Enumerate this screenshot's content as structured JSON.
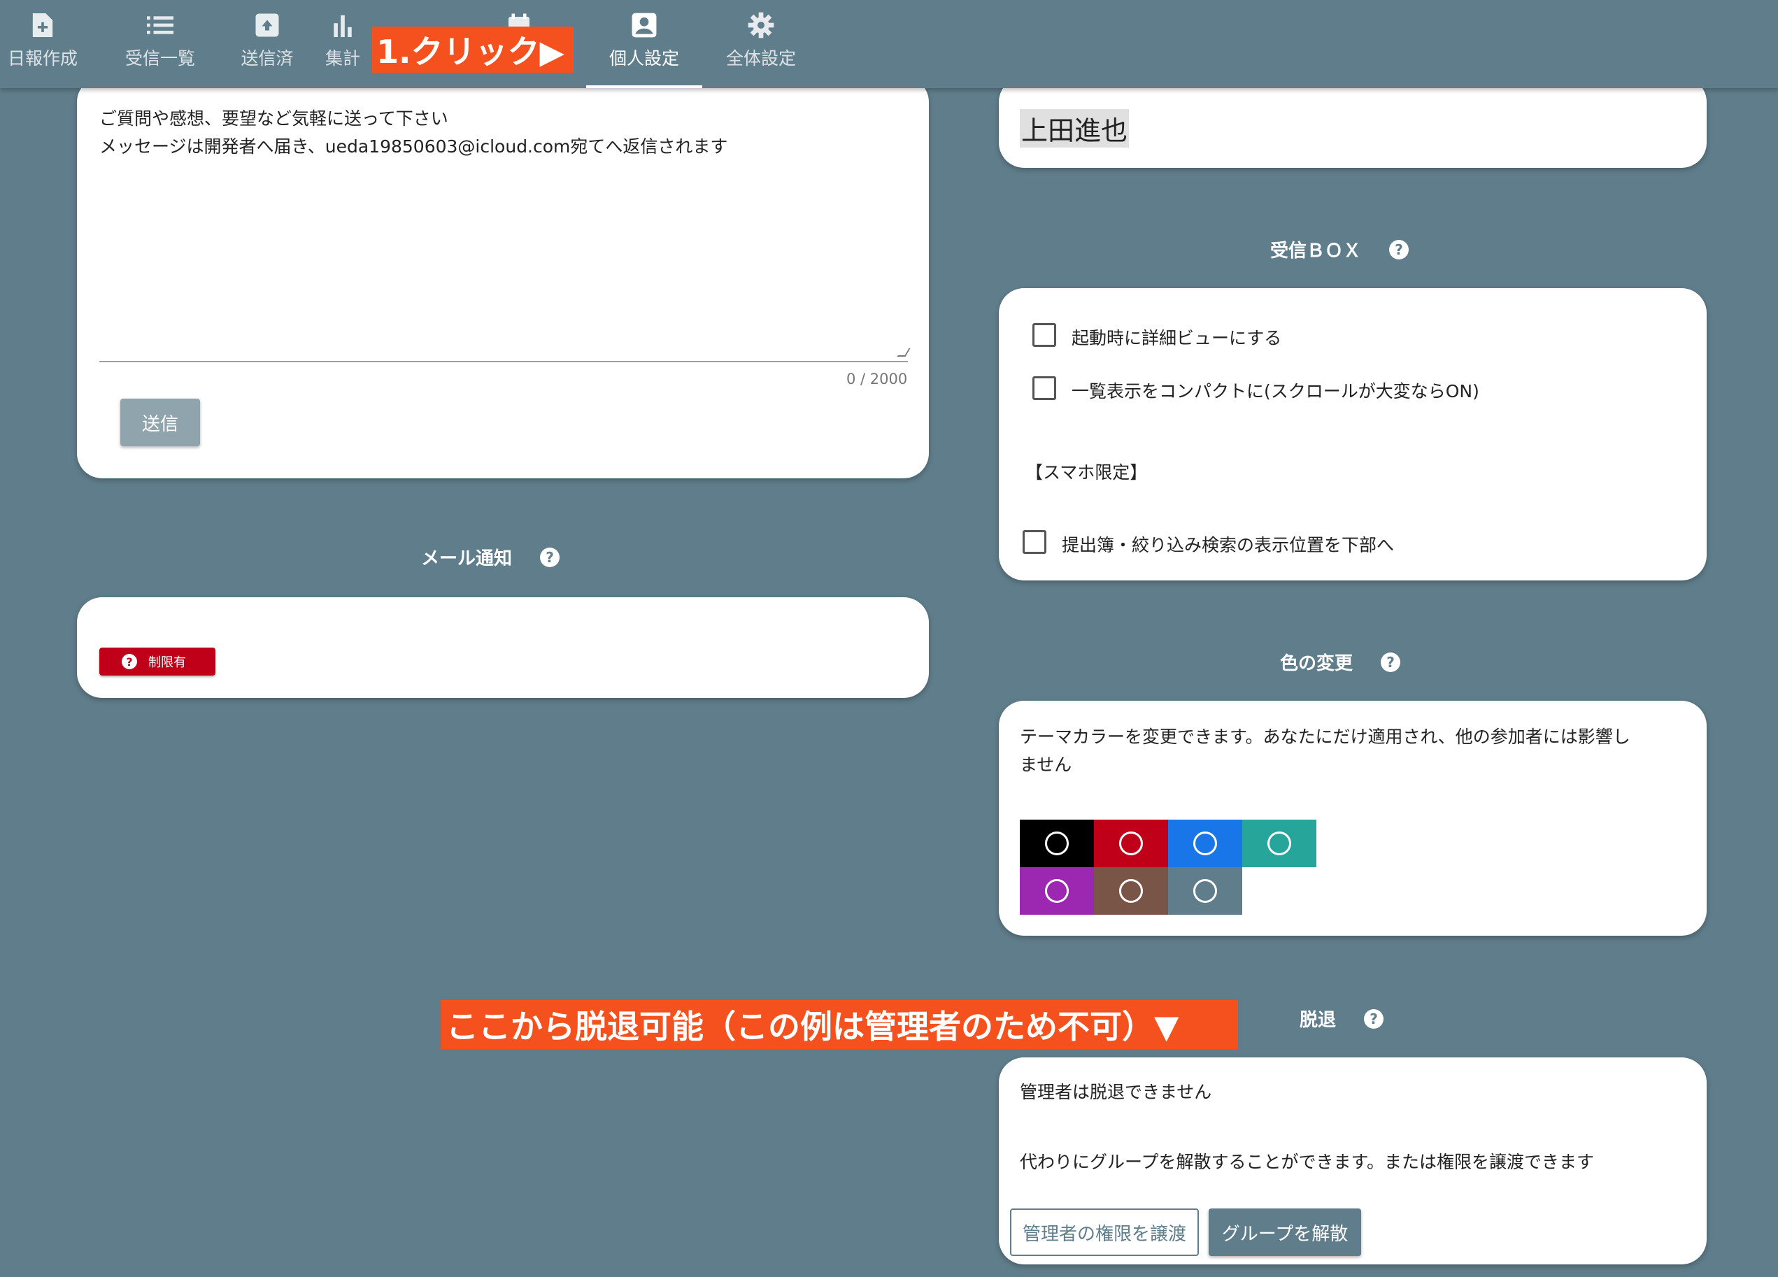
{
  "nav": {
    "tabs": [
      {
        "label": "日報作成",
        "icon": "file-plus-icon"
      },
      {
        "label": "受信一覧",
        "icon": "list-icon"
      },
      {
        "label": "送信済",
        "icon": "archive-icon"
      },
      {
        "label": "集計",
        "icon": "bar-chart-icon"
      },
      {
        "label": "",
        "icon": "calendar-icon"
      },
      {
        "label": "個人設定",
        "icon": "account-box-icon",
        "active": true
      },
      {
        "label": "全体設定",
        "icon": "gear-icon"
      }
    ]
  },
  "annotations": {
    "click_callout": "1.クリック▶",
    "withdraw_callout": "ここから脱退可能（この例は管理者のため不可）▼"
  },
  "feedback": {
    "line1": "ご質問や感想、要望など気軽に送って下さい",
    "line2": "メッセージは開発者へ届き、ueda19850603@icloud.com宛てへ返信されます",
    "counter": "0 / 2000",
    "send_label": "送信"
  },
  "mail_notification": {
    "title": "メール通知",
    "badge_label": "制限有"
  },
  "name_field": {
    "value": "上田進也"
  },
  "inbox": {
    "title": "受信ＢＯＸ",
    "option1": "起動時に詳細ビューにする",
    "option2": "一覧表示をコンパクトに(スクロールが大変ならON)",
    "smartphone_heading": "【スマホ限定】",
    "option3": "提出簿・絞り込み検索の表示位置を下部へ"
  },
  "color": {
    "title": "色の変更",
    "desc1": "テーマカラーを変更できます。あなたにだけ適用され、他の参加者には影響し",
    "desc2": "ません",
    "swatches": [
      "#000000",
      "#c00018",
      "#1976e8",
      "#26a69a",
      "#9c27b0",
      "#795548",
      "#607d8b"
    ]
  },
  "withdraw": {
    "title": "脱退",
    "line1": "管理者は脱退できません",
    "line2": "代わりにグループを解散することができます。または権限を譲渡できます",
    "transfer_label": "管理者の権限を譲渡",
    "dissolve_label": "グループを解散"
  }
}
